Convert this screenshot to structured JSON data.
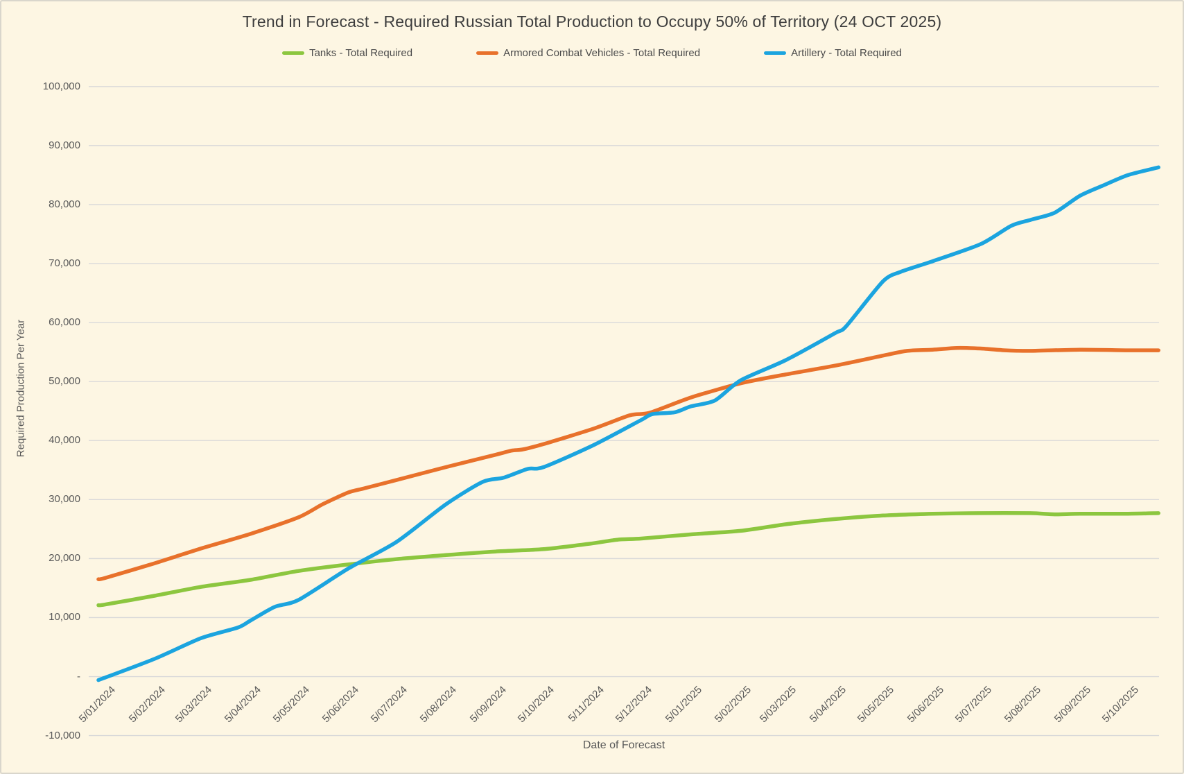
{
  "title": "Trend in Forecast - Required Russian Total Production to Occupy 50% of Territory (24 OCT 2025)",
  "axes": {
    "x_title": "Date of Forecast",
    "y_title": "Required Production Per Year",
    "y_ticks": [
      {
        "label": "100,000",
        "value": 100000
      },
      {
        "label": "90,000",
        "value": 90000
      },
      {
        "label": "80,000",
        "value": 80000
      },
      {
        "label": "70,000",
        "value": 70000
      },
      {
        "label": "60,000",
        "value": 60000
      },
      {
        "label": "50,000",
        "value": 50000
      },
      {
        "label": "40,000",
        "value": 40000
      },
      {
        "label": "30,000",
        "value": 30000
      },
      {
        "label": "20,000",
        "value": 20000
      },
      {
        "label": "10,000",
        "value": 10000
      },
      {
        "label": "-",
        "value": 0
      },
      {
        "label": "-10,000",
        "value": -10000
      }
    ],
    "x_tick_labels": [
      "5/01/2024",
      "5/02/2024",
      "5/03/2024",
      "5/04/2024",
      "5/05/2024",
      "5/06/2024",
      "5/07/2024",
      "5/08/2024",
      "5/09/2024",
      "5/10/2024",
      "5/11/2024",
      "5/12/2024",
      "5/01/2025",
      "5/02/2025",
      "5/03/2025",
      "5/04/2025",
      "5/05/2025",
      "5/06/2025",
      "5/07/2025",
      "5/08/2025",
      "5/09/2025",
      "5/10/2025"
    ]
  },
  "colors": {
    "tanks": "#8cc63f",
    "acv": "#e8712b",
    "artillery": "#1ba4df",
    "gridline": "#d9d9d9"
  },
  "chart_data": {
    "type": "line",
    "title": "Trend in Forecast - Required Russian Total Production to Occupy 50% of Territory (24 OCT 2025)",
    "xlabel": "Date of Forecast",
    "ylabel": "Required Production Per Year",
    "ylim": [
      -10000,
      100000
    ],
    "x_domain": [
      "2024-01-01",
      "2025-10-24"
    ],
    "grid": "horizontal",
    "legend_position": "top",
    "series": [
      {
        "name": "Tanks - Total Required",
        "id": "tanks",
        "color": "#8cc63f",
        "points": [
          [
            "2024-01-01",
            12100
          ],
          [
            "2024-01-05",
            12200
          ],
          [
            "2024-02-05",
            13700
          ],
          [
            "2024-03-05",
            15200
          ],
          [
            "2024-04-05",
            16400
          ],
          [
            "2024-05-05",
            17900
          ],
          [
            "2024-06-05",
            19000
          ],
          [
            "2024-07-05",
            19900
          ],
          [
            "2024-08-05",
            20600
          ],
          [
            "2024-09-05",
            21200
          ],
          [
            "2024-10-05",
            21600
          ],
          [
            "2024-11-05",
            22600
          ],
          [
            "2024-11-20",
            23200
          ],
          [
            "2024-12-05",
            23400
          ],
          [
            "2025-01-05",
            24100
          ],
          [
            "2025-02-05",
            24700
          ],
          [
            "2025-03-05",
            25800
          ],
          [
            "2025-04-05",
            26700
          ],
          [
            "2025-05-05",
            27300
          ],
          [
            "2025-06-05",
            27600
          ],
          [
            "2025-07-05",
            27700
          ],
          [
            "2025-08-05",
            27700
          ],
          [
            "2025-08-20",
            27500
          ],
          [
            "2025-09-05",
            27600
          ],
          [
            "2025-10-05",
            27600
          ],
          [
            "2025-10-24",
            27700
          ]
        ]
      },
      {
        "name": "Armored Combat Vehicles - Total Required",
        "id": "acv",
        "color": "#e8712b",
        "points": [
          [
            "2024-01-01",
            16500
          ],
          [
            "2024-01-05",
            16700
          ],
          [
            "2024-02-05",
            19200
          ],
          [
            "2024-03-05",
            21700
          ],
          [
            "2024-04-05",
            24200
          ],
          [
            "2024-05-05",
            27000
          ],
          [
            "2024-05-20",
            29200
          ],
          [
            "2024-06-05",
            31200
          ],
          [
            "2024-06-15",
            31900
          ],
          [
            "2024-07-05",
            33300
          ],
          [
            "2024-08-05",
            35500
          ],
          [
            "2024-09-05",
            37600
          ],
          [
            "2024-09-15",
            38300
          ],
          [
            "2024-09-22",
            38500
          ],
          [
            "2024-10-05",
            39400
          ],
          [
            "2024-11-05",
            42000
          ],
          [
            "2024-11-28",
            44300
          ],
          [
            "2024-12-10",
            44700
          ],
          [
            "2025-01-05",
            47300
          ],
          [
            "2025-02-05",
            49700
          ],
          [
            "2025-03-05",
            51200
          ],
          [
            "2025-04-05",
            52700
          ],
          [
            "2025-05-05",
            54400
          ],
          [
            "2025-05-20",
            55200
          ],
          [
            "2025-06-05",
            55400
          ],
          [
            "2025-06-20",
            55700
          ],
          [
            "2025-07-05",
            55600
          ],
          [
            "2025-07-20",
            55300
          ],
          [
            "2025-08-05",
            55200
          ],
          [
            "2025-09-05",
            55400
          ],
          [
            "2025-10-05",
            55300
          ],
          [
            "2025-10-24",
            55300
          ]
        ]
      },
      {
        "name": "Artillery - Total Required",
        "id": "artillery",
        "color": "#1ba4df",
        "points": [
          [
            "2024-01-01",
            -600
          ],
          [
            "2024-02-05",
            3000
          ],
          [
            "2024-03-05",
            6500
          ],
          [
            "2024-03-28",
            8300
          ],
          [
            "2024-04-05",
            9500
          ],
          [
            "2024-04-20",
            11800
          ],
          [
            "2024-05-05",
            13000
          ],
          [
            "2024-06-05",
            18300
          ],
          [
            "2024-07-05",
            22800
          ],
          [
            "2024-08-05",
            29200
          ],
          [
            "2024-08-28",
            33000
          ],
          [
            "2024-09-10",
            33700
          ],
          [
            "2024-09-25",
            35200
          ],
          [
            "2024-10-05",
            35500
          ],
          [
            "2024-11-05",
            39200
          ],
          [
            "2024-12-05",
            43500
          ],
          [
            "2024-12-12",
            44500
          ],
          [
            "2024-12-26",
            44800
          ],
          [
            "2025-01-05",
            45800
          ],
          [
            "2025-01-20",
            46800
          ],
          [
            "2025-02-05",
            50200
          ],
          [
            "2025-03-05",
            53600
          ],
          [
            "2025-04-05",
            58200
          ],
          [
            "2025-04-12",
            59400
          ],
          [
            "2025-05-05",
            67000
          ],
          [
            "2025-05-16",
            68600
          ],
          [
            "2025-06-05",
            70400
          ],
          [
            "2025-07-05",
            73300
          ],
          [
            "2025-07-24",
            76400
          ],
          [
            "2025-08-05",
            77400
          ],
          [
            "2025-08-20",
            78600
          ],
          [
            "2025-09-05",
            81500
          ],
          [
            "2025-09-20",
            83300
          ],
          [
            "2025-10-05",
            85000
          ],
          [
            "2025-10-24",
            86300
          ]
        ]
      }
    ]
  }
}
